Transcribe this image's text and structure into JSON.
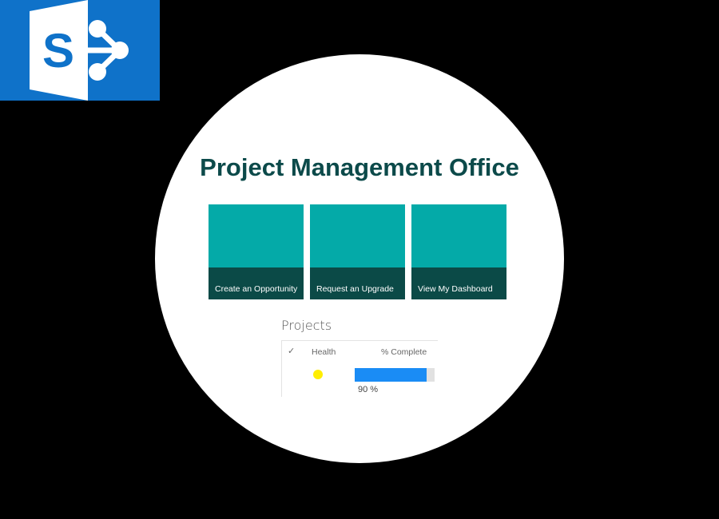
{
  "logo": {
    "icon": "sharepoint-icon",
    "letter": "S",
    "background": "#0f72c9"
  },
  "page": {
    "title": "Project Management Office",
    "title_color": "#0c4a4a"
  },
  "tiles": [
    {
      "label": "Create an Opportunity"
    },
    {
      "label": "Request an Upgrade"
    },
    {
      "label": "View My Dashboard"
    }
  ],
  "tile_colors": {
    "top": "#04aaa8",
    "caption": "#0b4a47"
  },
  "projects": {
    "title": "Projects",
    "columns": {
      "check_icon": "checkmark-icon",
      "health": "Health",
      "complete": "% Complete"
    },
    "rows": [
      {
        "health_color": "#ffee00",
        "percent_complete": 0.9,
        "percent_text": "90 %"
      }
    ],
    "progress_color": "#1a8cf5"
  }
}
